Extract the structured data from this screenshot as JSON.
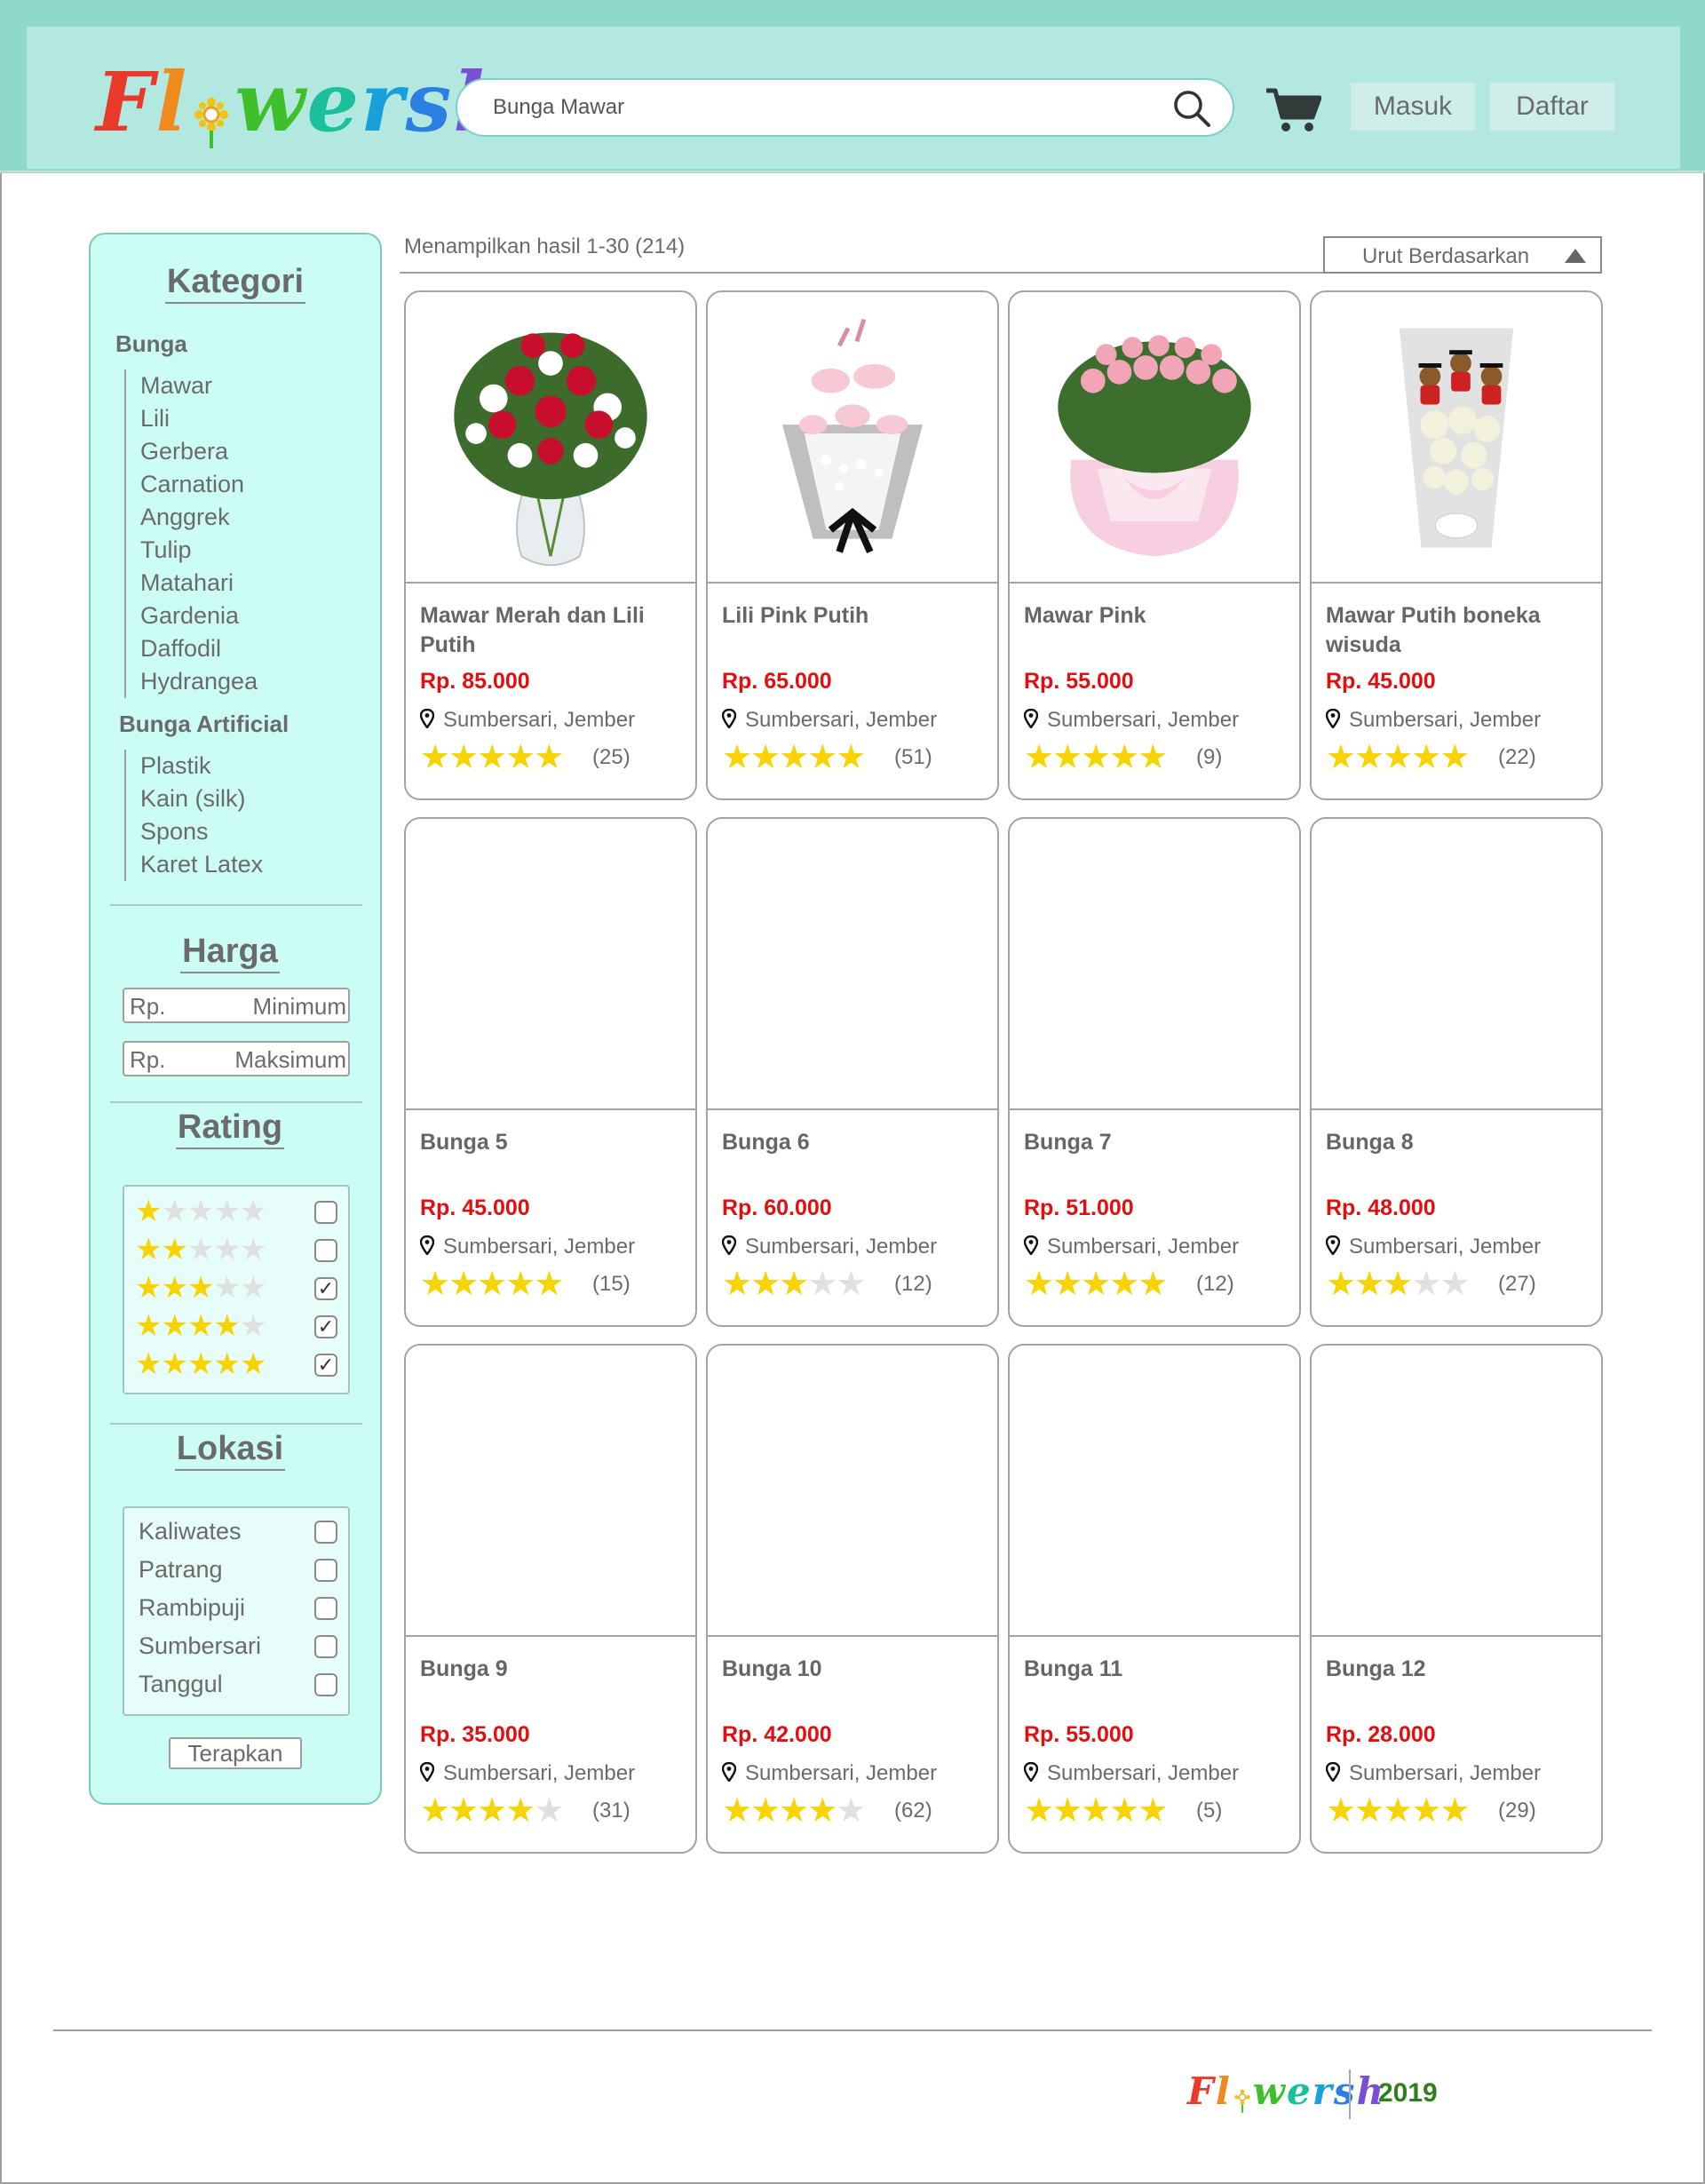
{
  "header": {
    "logo_text": "Flowersh",
    "search": {
      "value": "Bunga Mawar",
      "icon": "search-icon"
    },
    "cart_icon": "cart-icon",
    "login_label": "Masuk",
    "register_label": "Daftar",
    "colors": {
      "header_bg": "#b3e8e1",
      "header_border": "#8fd8cc"
    }
  },
  "sidebar": {
    "kategori_title": "Kategori",
    "groups": [
      {
        "title": "Bunga",
        "items": [
          "Mawar",
          "Lili",
          "Gerbera",
          "Carnation",
          "Anggrek",
          "Tulip",
          "Matahari",
          "Gardenia",
          "Daffodil",
          "Hydrangea"
        ]
      },
      {
        "title": "Bunga Artificial",
        "items": [
          "Plastik",
          "Kain (silk)",
          "Spons",
          "Karet Latex"
        ]
      }
    ],
    "harga_title": "Harga",
    "price_min": {
      "prefix": "Rp.",
      "placeholder": "Minimum"
    },
    "price_max": {
      "prefix": "Rp.",
      "placeholder": "Maksimum"
    },
    "rating_title": "Rating",
    "rating_filters": [
      {
        "stars": 1,
        "checked": false
      },
      {
        "stars": 2,
        "checked": false
      },
      {
        "stars": 3,
        "checked": true
      },
      {
        "stars": 4,
        "checked": true
      },
      {
        "stars": 5,
        "checked": true
      }
    ],
    "lokasi_title": "Lokasi",
    "locations": [
      {
        "name": "Kaliwates",
        "checked": false
      },
      {
        "name": "Patrang",
        "checked": false
      },
      {
        "name": "Rambipuji",
        "checked": false
      },
      {
        "name": "Sumbersari",
        "checked": false
      },
      {
        "name": "Tanggul",
        "checked": false
      }
    ],
    "apply_label": "Terapkan",
    "colors": {
      "sidebar_bg": "#ccfdf5"
    }
  },
  "results": {
    "count_text": "Menampilkan hasil 1-30 (214)",
    "sort_label": "Urut Berdasarkan",
    "sort_icon": "triangle-up-icon"
  },
  "products": [
    {
      "name": "Mawar Merah dan Lili Putih",
      "price": "Rp. 85.000",
      "location": "Sumbersari, Jember",
      "rating": 5,
      "count": "(25)",
      "image": "red-roses-vase"
    },
    {
      "name": "Lili Pink Putih",
      "price": "Rp. 65.000",
      "location": "Sumbersari, Jember",
      "rating": 5,
      "count": "(51)",
      "image": "pink-lily-bouquet"
    },
    {
      "name": "Mawar Pink",
      "price": "Rp. 55.000",
      "location": "Sumbersari, Jember",
      "rating": 5,
      "count": "(9)",
      "image": "pink-rose-bouquet"
    },
    {
      "name": "Mawar Putih boneka wisuda",
      "price": "Rp. 45.000",
      "location": "Sumbersari, Jember",
      "rating": 5,
      "count": "(22)",
      "image": "white-rose-graduation-bouquet"
    },
    {
      "name": "Bunga 5",
      "price": "Rp. 45.000",
      "location": "Sumbersari, Jember",
      "rating": 5,
      "count": "(15)",
      "image": ""
    },
    {
      "name": "Bunga 6",
      "price": "Rp. 60.000",
      "location": "Sumbersari, Jember",
      "rating": 3,
      "count": "(12)",
      "image": ""
    },
    {
      "name": "Bunga 7",
      "price": "Rp. 51.000",
      "location": "Sumbersari, Jember",
      "rating": 5,
      "count": "(12)",
      "image": ""
    },
    {
      "name": "Bunga 8",
      "price": "Rp. 48.000",
      "location": "Sumbersari, Jember",
      "rating": 3,
      "count": "(27)",
      "image": ""
    },
    {
      "name": "Bunga 9",
      "price": "Rp. 35.000",
      "location": "Sumbersari, Jember",
      "rating": 4,
      "count": "(31)",
      "image": ""
    },
    {
      "name": "Bunga 10",
      "price": "Rp. 42.000",
      "location": "Sumbersari, Jember",
      "rating": 4,
      "count": "(62)",
      "image": ""
    },
    {
      "name": "Bunga 11",
      "price": "Rp. 55.000",
      "location": "Sumbersari, Jember",
      "rating": 5,
      "count": "(5)",
      "image": ""
    },
    {
      "name": "Bunga 12",
      "price": "Rp. 28.000",
      "location": "Sumbersari, Jember",
      "rating": 5,
      "count": "(29)",
      "image": ""
    }
  ],
  "footer": {
    "logo_text": "Flowersh",
    "year": "2019"
  },
  "colors": {
    "price": "#e01010",
    "star": "#f7d300",
    "star_empty": "#e0e0e0"
  }
}
